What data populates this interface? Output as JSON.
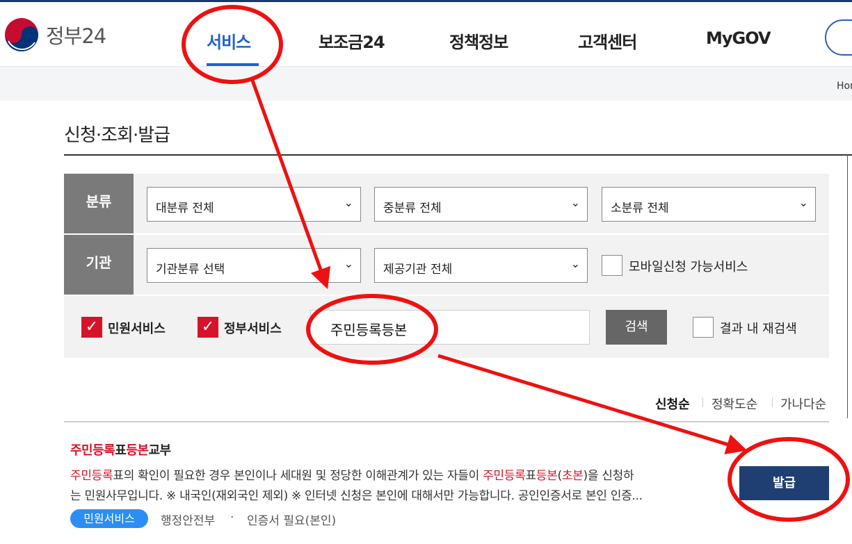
{
  "header": {
    "logo_text": "정부24",
    "nav": [
      {
        "label": "서비스",
        "active": true
      },
      {
        "label": "보조금24",
        "active": false
      },
      {
        "label": "정책정보",
        "active": false
      },
      {
        "label": "고객센터",
        "active": false
      },
      {
        "label": "MyGOV",
        "active": false
      }
    ]
  },
  "breadcrumb": {
    "text": "Home"
  },
  "page": {
    "title": "신청·조회·발급"
  },
  "filter": {
    "category_label": "분류",
    "agency_label": "기관",
    "major_category": "대분류 전체",
    "middle_category": "중분류 전체",
    "minor_category": "소분류 전체",
    "agency_type": "기관분류 선택",
    "provider_agency": "제공기관 전체",
    "mobile_label": "모바일신청 가능서비스",
    "mobile_checked": false,
    "civil_service_label": "민원서비스",
    "civil_service_checked": true,
    "gov_service_label": "정부서비스",
    "gov_service_checked": true,
    "search_value": "주민등록등본",
    "search_button": "검색",
    "research_label": "결과 내 재검색",
    "research_checked": false
  },
  "sort": {
    "options": [
      "신청순",
      "정확도순",
      "가나다순"
    ],
    "active": "신청순"
  },
  "results": [
    {
      "title_parts": [
        "주민등록",
        "표",
        "등본",
        "교부"
      ],
      "desc_line1_parts": [
        "주민등록",
        "표의 확인이 필요한 경우 본인이나 세대원 및 정당한 이해관계가 있는 자들이 ",
        "주민등록",
        "표",
        "등본",
        "(",
        "초본",
        ")을 신청하"
      ],
      "desc_line2": "는 민원사무입니다. ※ 내국인(재외국인 제외) ※ 인터넷 신청은 본인에 대해서만 가능합니다. 공인인증서로 본인 인증...",
      "tag": "민원서비스",
      "agency": "행정안전부",
      "cert": "인증서 필요(본인)",
      "button": "발급"
    }
  ],
  "colors": {
    "accent_blue": "#1e63c8",
    "highlight_red": "#d5142a",
    "annotation_red": "#ee1111",
    "issue_button": "#1f3f72",
    "tag_blue": "#2a8ef2"
  }
}
